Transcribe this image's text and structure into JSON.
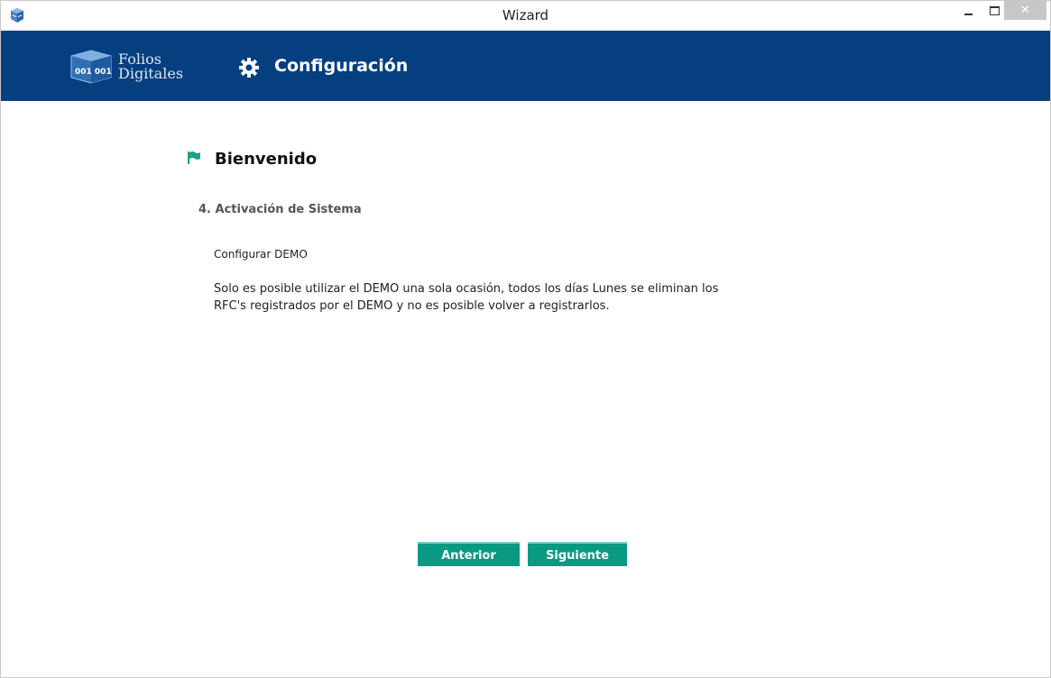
{
  "window": {
    "title": "Wizard",
    "close_glyph": "✕"
  },
  "header": {
    "logo_line1": "Folios",
    "logo_line2": "Digitales",
    "logo_box_text": "001 001",
    "title": "Configuración",
    "background_color": "#053f80"
  },
  "content": {
    "welcome_title": "Bienvenido",
    "step_title": "4. Activación de Sistema",
    "step_subtitle": "Configurar DEMO",
    "step_description": "Solo es posible utilizar el DEMO una sola ocasión, todos los días Lunes se eliminan los RFC's registrados por el DEMO y no es posible volver a registrarlos."
  },
  "buttons": {
    "previous_label": "Anterior",
    "next_label": "Siguiente",
    "color": "#0a9a84"
  },
  "icons": {
    "app": "app-cube-icon",
    "settings": "gear-icon",
    "flag": "flag-icon"
  }
}
